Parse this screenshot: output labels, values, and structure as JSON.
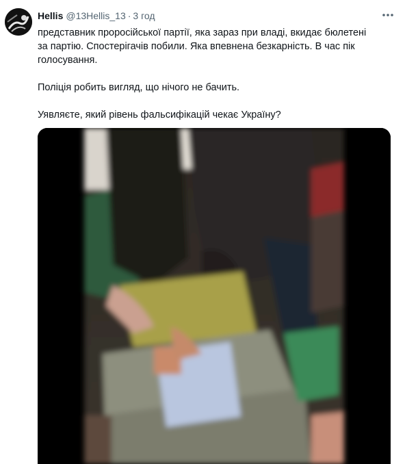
{
  "tweet": {
    "author_name": "Hellis",
    "author_handle": "@13Hellis_13",
    "separator": "·",
    "time": "3 год",
    "more_icon": "more-horizontal-icon",
    "paragraphs": [
      "представник проросійської партії, яка зараз при владі, вкидає бюлетені\nза партію. Спостерігачів побили. Яка впевнена безкарність. В час пік\nголосування.",
      "Поліція робить вигляд, що нічого не бачить.",
      "Уявляєте, який рівень фальсифікацій чекає Україну?"
    ],
    "media_type": "video"
  }
}
